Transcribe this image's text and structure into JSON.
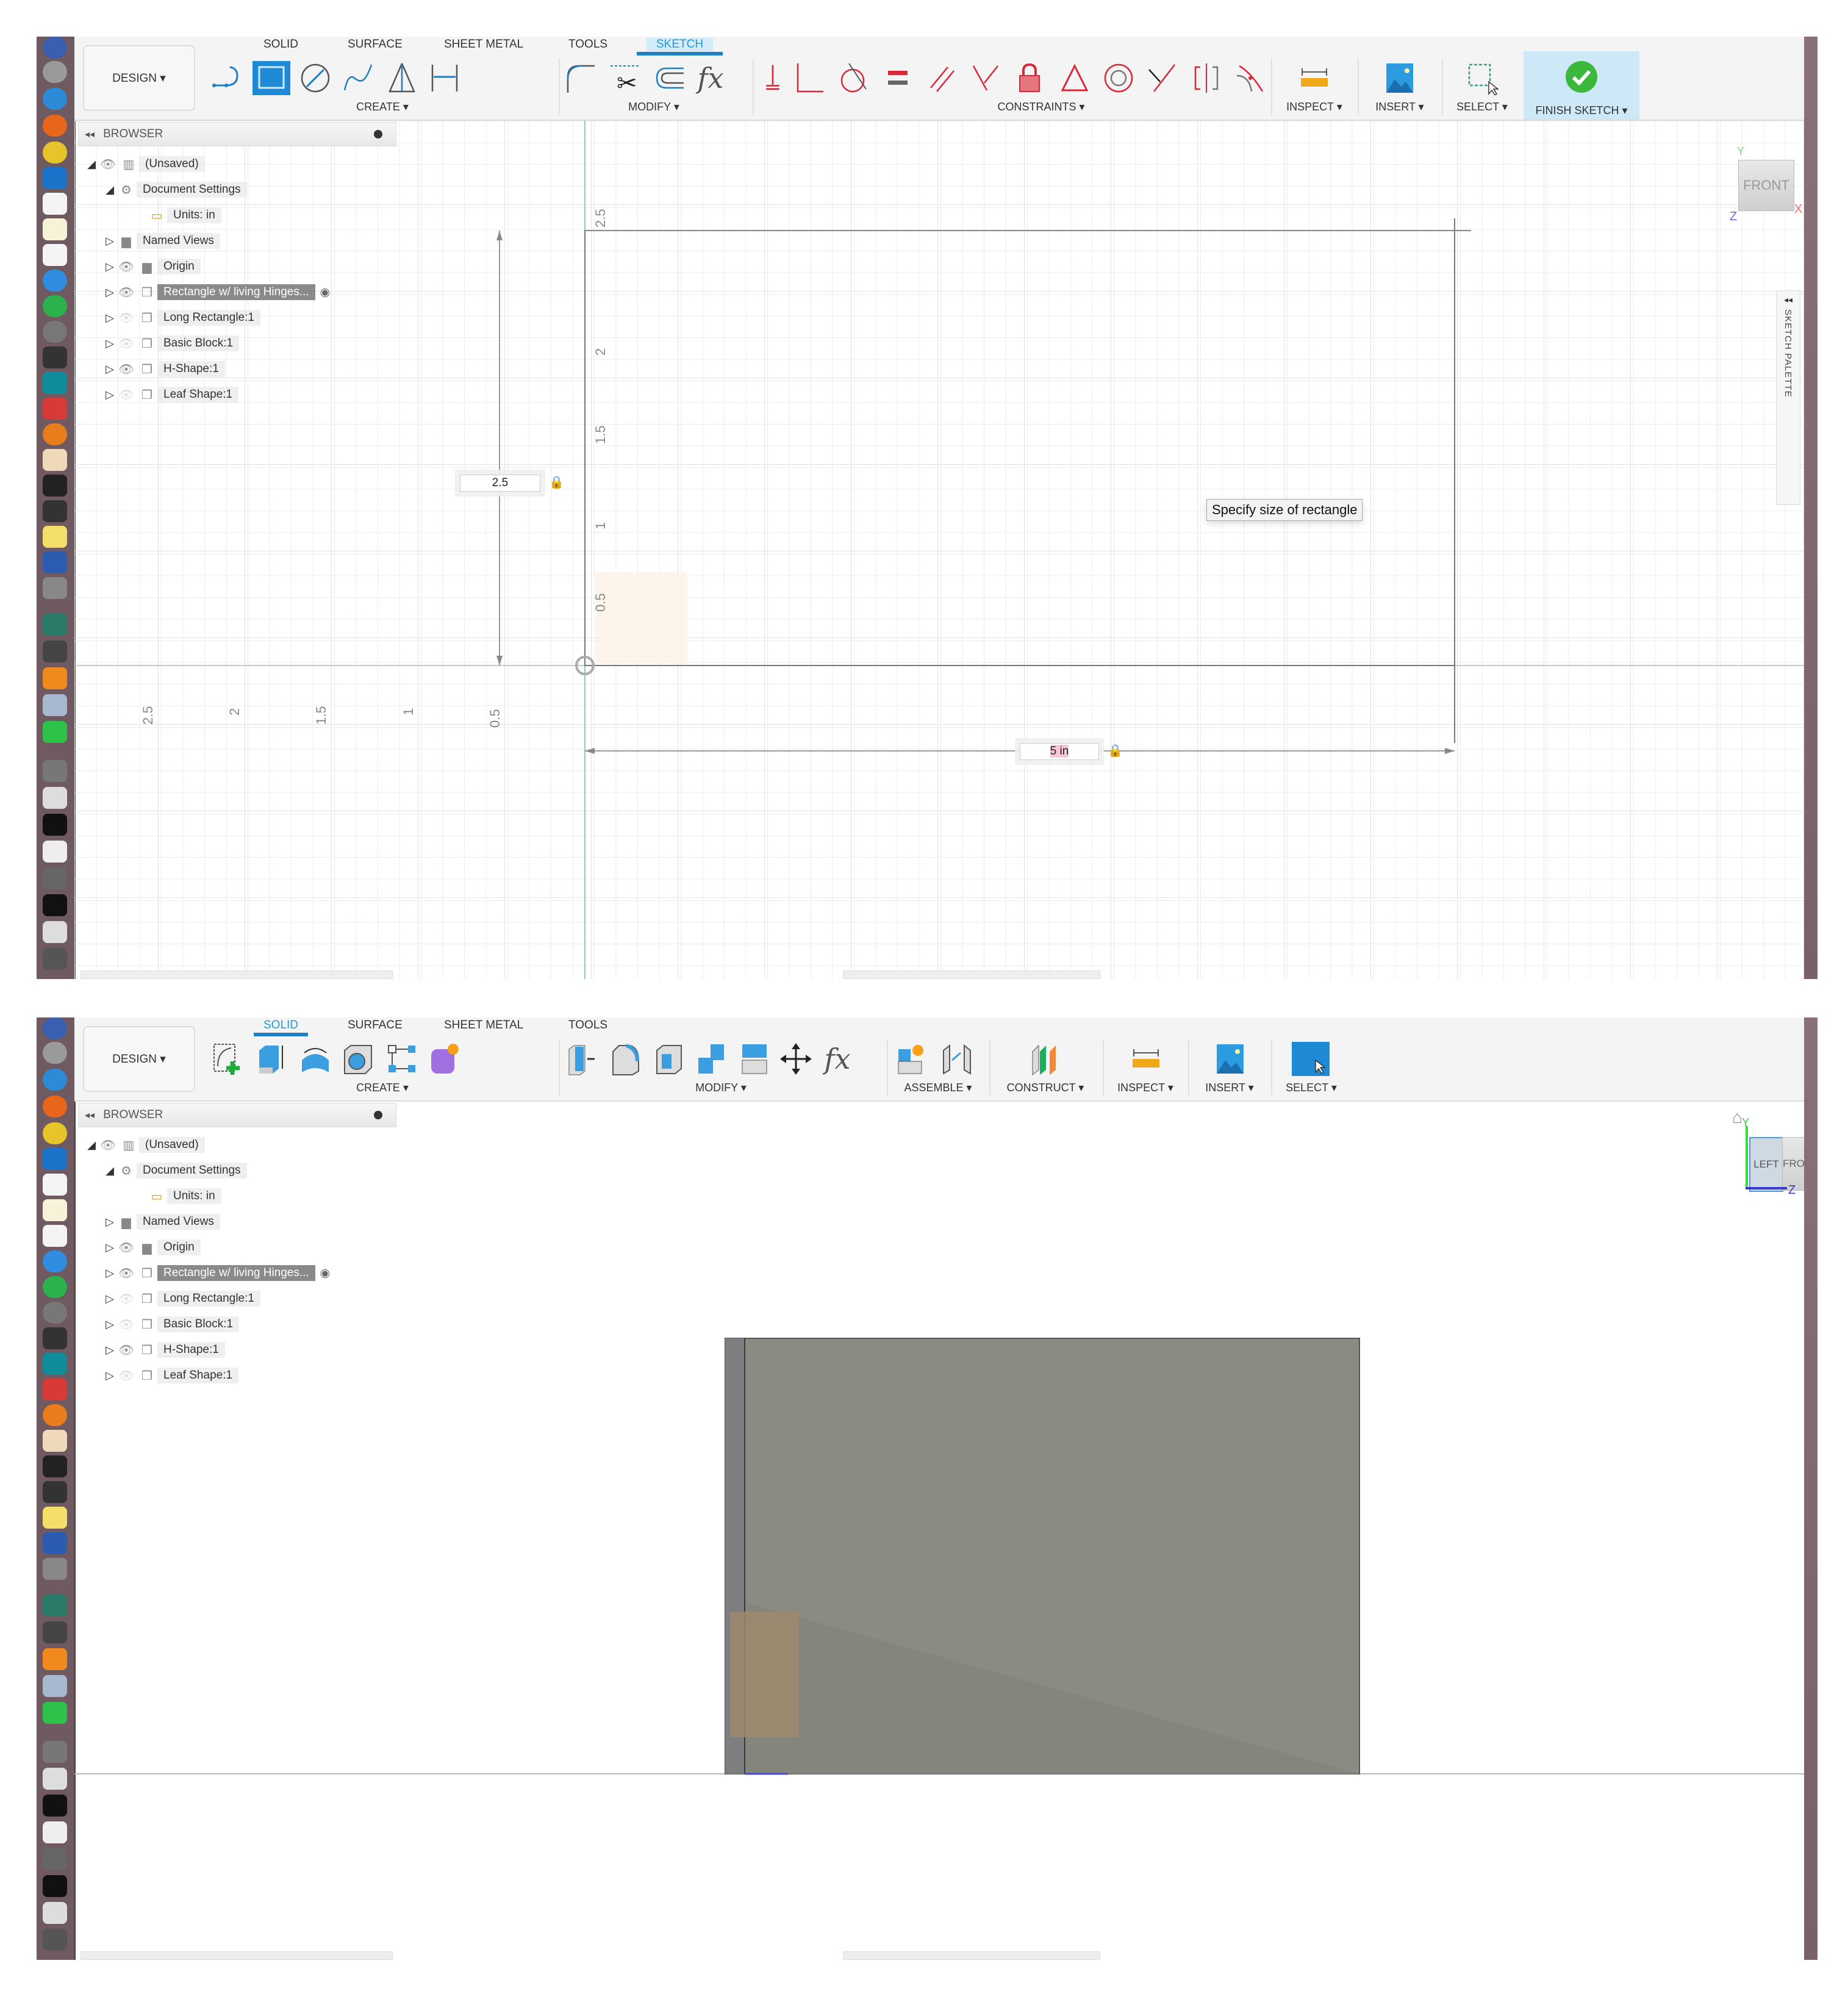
{
  "panels": [
    {
      "id": "sketch-mode",
      "workspace_button": "DESIGN ▾",
      "tabs": [
        {
          "label": "SOLID",
          "active": false
        },
        {
          "label": "SURFACE",
          "active": false
        },
        {
          "label": "SHEET METAL",
          "active": false
        },
        {
          "label": "TOOLS",
          "active": false
        },
        {
          "label": "SKETCH",
          "active": true
        }
      ],
      "groups": {
        "create": "CREATE ▾",
        "modify": "MODIFY ▾",
        "constraints": "CONSTRAINTS ▾",
        "inspect": "INSPECT ▾",
        "insert": "INSERT ▾",
        "select": "SELECT ▾",
        "finish": "FINISH SKETCH ▾"
      },
      "create_tools": [
        "line-icon",
        "rectangle-icon",
        "circle-icon",
        "spline-icon",
        "triangle-icon",
        "dimension-icon"
      ],
      "modify_tools": [
        "fillet-icon",
        "trim-icon",
        "offset-icon",
        "fx-icon"
      ],
      "fx_label": "fx",
      "constraint_tools": [
        "fix-icon",
        "coincident-icon",
        "tangent-icon",
        "equal-icon",
        "parallel-icon",
        "perpendicular-icon",
        "lock-icon",
        "triangle-constraint-icon",
        "concentric-icon",
        "midpoint-icon",
        "symmetry-icon",
        "curvature-icon"
      ],
      "viewport": {
        "tooltip": "Specify size of rectangle",
        "height_input": "2.5",
        "width_input": "5 in",
        "y_axis_labels": [
          "0.5",
          "1",
          "1.5",
          "2",
          "2.5"
        ],
        "x_axis_neg_labels": [
          "0.5",
          "1",
          "1.5",
          "2",
          "2.5"
        ],
        "viewcube_face": "FRONT",
        "axis_x": "X",
        "axis_y": "Y",
        "axis_z": "Z",
        "sketch_palette": "SKETCH PALETTE"
      }
    },
    {
      "id": "solid-mode",
      "workspace_button": "DESIGN ▾",
      "tabs": [
        {
          "label": "SOLID",
          "active": true
        },
        {
          "label": "SURFACE",
          "active": false
        },
        {
          "label": "SHEET METAL",
          "active": false
        },
        {
          "label": "TOOLS",
          "active": false
        }
      ],
      "groups": {
        "create": "CREATE ▾",
        "modify": "MODIFY ▾",
        "assemble": "ASSEMBLE ▾",
        "construct": "CONSTRUCT ▾",
        "inspect": "INSPECT ▾",
        "insert": "INSERT ▾",
        "select": "SELECT ▾"
      },
      "fx_label": "fx",
      "viewport": {
        "viewcube_left": "LEFT",
        "viewcube_front": "FRONT",
        "axis_y": "Y",
        "axis_z": "Z"
      }
    }
  ],
  "browser": {
    "title": "BROWSER",
    "items": [
      {
        "label": "(Unsaved)",
        "level": 0,
        "expanded": true,
        "visible": true,
        "icon": "component-icon"
      },
      {
        "label": "Document Settings",
        "level": 1,
        "expanded": true,
        "icon": "gear-icon"
      },
      {
        "label": "Units: in",
        "level": 2,
        "icon": "document-icon"
      },
      {
        "label": "Named Views",
        "level": 1,
        "expanded": false,
        "icon": "folder-icon"
      },
      {
        "label": "Origin",
        "level": 1,
        "expanded": false,
        "visible": true,
        "icon": "folder-icon"
      },
      {
        "label": "Rectangle w/ living Hinges...",
        "level": 1,
        "expanded": false,
        "visible": true,
        "selected": true,
        "icon": "component-icon"
      },
      {
        "label": "Long Rectangle:1",
        "level": 1,
        "expanded": false,
        "visible": false,
        "icon": "component-icon"
      },
      {
        "label": "Basic Block:1",
        "level": 1,
        "expanded": false,
        "visible": false,
        "icon": "component-icon"
      },
      {
        "label": "H-Shape:1",
        "level": 1,
        "expanded": false,
        "visible": true,
        "icon": "component-icon"
      },
      {
        "label": "Leaf Shape:1",
        "level": 1,
        "expanded": false,
        "visible": false,
        "icon": "component-icon"
      }
    ]
  },
  "colors": {
    "accent": "#1e9ad6",
    "finish_sketch_bg": "#cde8f7",
    "finish_check": "#3cb83c",
    "constraint_red": "#d8283a",
    "body_gray": "#8a8b82",
    "dock_bg": "#6e5a60"
  }
}
